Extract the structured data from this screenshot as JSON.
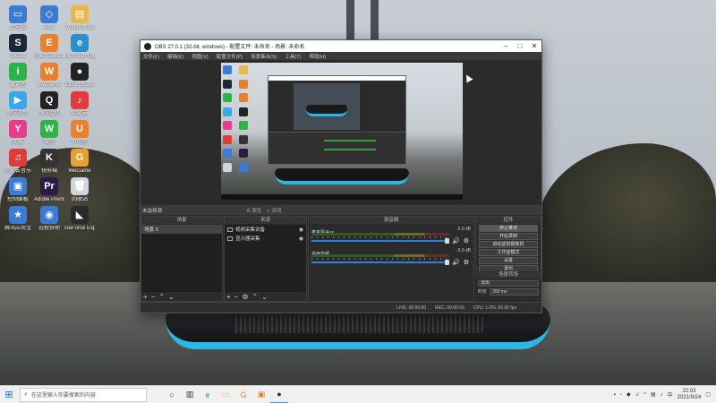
{
  "desktop_icons": [
    {
      "label": "此电脑",
      "glyph": "▭",
      "color": "#3a7bd5"
    },
    {
      "label": "网络",
      "glyph": "◇",
      "color": "#3a7bd5"
    },
    {
      "label": "Administrator",
      "glyph": "▤",
      "color": "#e8b84a"
    },
    {
      "label": "Steam",
      "glyph": "S",
      "color": "#1b2838"
    },
    {
      "label": "Epic Games",
      "glyph": "E",
      "color": "#e8802e"
    },
    {
      "label": "Microsoft Edge",
      "glyph": "e",
      "color": "#2a8fcf"
    },
    {
      "label": "爱奇艺",
      "glyph": "i",
      "color": "#2cb34a"
    },
    {
      "label": "WeGame",
      "glyph": "W",
      "color": "#e8802e"
    },
    {
      "label": "OBS Studio",
      "glyph": "●",
      "color": "#222"
    },
    {
      "label": "腾讯视频",
      "glyph": "▶",
      "color": "#3aa7e8"
    },
    {
      "label": "腾讯QQ",
      "glyph": "Q",
      "color": "#222"
    },
    {
      "label": "网易云",
      "glyph": "♪",
      "color": "#e33b3b"
    },
    {
      "label": "优酷",
      "glyph": "Y",
      "color": "#e83b8a"
    },
    {
      "label": "微信",
      "glyph": "W",
      "color": "#2cb34a"
    },
    {
      "label": "U号租",
      "glyph": "U",
      "color": "#e8802e"
    },
    {
      "label": "网易云音乐",
      "glyph": "♫",
      "color": "#e33b3b"
    },
    {
      "label": "快剪辑",
      "glyph": "K",
      "color": "#333"
    },
    {
      "label": "WeGame",
      "glyph": "G",
      "color": "#e8a02e"
    },
    {
      "label": "控制面板",
      "glyph": "▣",
      "color": "#3a7bd5"
    },
    {
      "label": "Adobe Premie...",
      "glyph": "Pr",
      "color": "#2a1a4a"
    },
    {
      "label": "回收站",
      "glyph": "🗑",
      "color": "#cfd6dd"
    },
    {
      "label": "腾讯应用宝",
      "glyph": "★",
      "color": "#3a7bd5"
    },
    {
      "label": "远程协助",
      "glyph": "◉",
      "color": "#3a7bd5"
    },
    {
      "label": "GeForce Experience",
      "glyph": "◣",
      "color": "#2b2b2b"
    }
  ],
  "obs": {
    "title": "OBS 27.0.1 (32-bit, windows) - 配置文件: 未命名 - 场景: 未命名",
    "menu": [
      "文件(F)",
      "编辑(E)",
      "视图(V)",
      "配置文件(P)",
      "场景集合(S)",
      "工具(T)",
      "帮助(H)"
    ],
    "scene_bar": {
      "no_source": "未选择源",
      "properties": "属性",
      "filters": "滤镜"
    },
    "scenes": {
      "title": "场景",
      "items": [
        "场景 3"
      ]
    },
    "sources": {
      "title": "来源",
      "items": [
        "视频采集设备",
        "显示器采集"
      ]
    },
    "mixer": {
      "title": "混音器",
      "channels": [
        {
          "name": "麦克风/Aux",
          "db": "0.0 dB"
        },
        {
          "name": "桌面音频",
          "db": "0.0 dB"
        }
      ]
    },
    "controls": {
      "title": "控件",
      "buttons": [
        "停止推流",
        "开始录制",
        "启动虚拟摄像机",
        "工作室模式",
        "设置",
        "退出"
      ]
    },
    "transitions": {
      "title": "场景转场",
      "selected": "淡出",
      "duration_label": "时长",
      "duration_value": "300 ms"
    },
    "status": {
      "live": "LIVE: 00:00:00",
      "rec": "REC: 00:00:00",
      "cpu": "CPU: 1.0%, 60.00 fps"
    }
  },
  "taskbar": {
    "search_placeholder": "在这里输入你要搜索的内容",
    "clock_time": "22:03",
    "clock_date": "2021/9/24"
  }
}
